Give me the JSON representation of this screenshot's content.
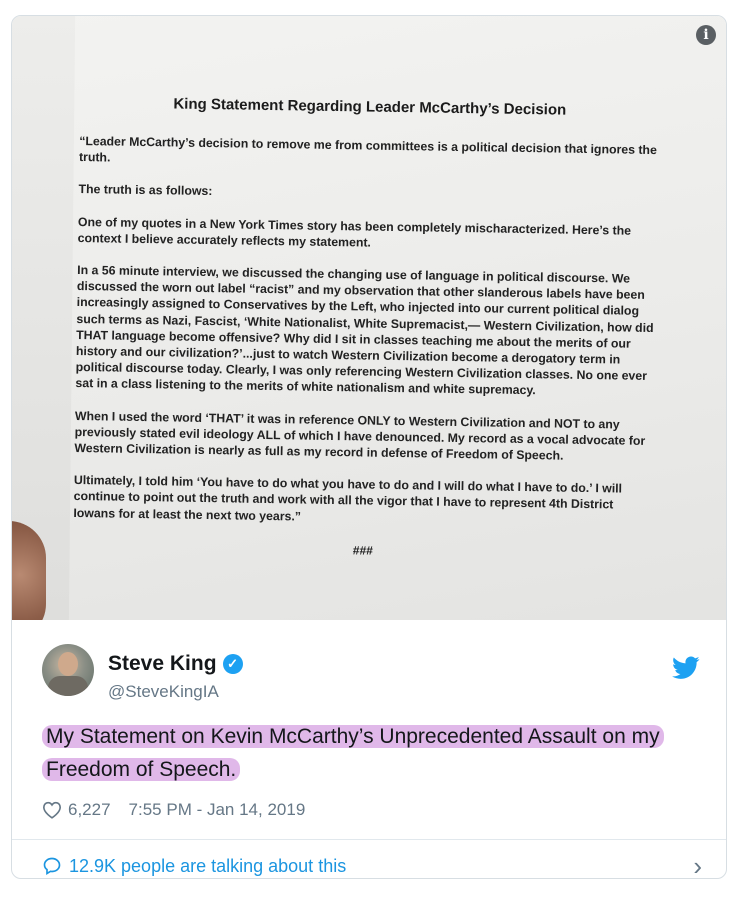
{
  "document": {
    "title": "King Statement Regarding Leader McCarthy’s Decision",
    "paragraphs": [
      "“Leader McCarthy’s decision to remove me from committees is a political decision that ignores the truth.",
      "The truth is as follows:",
      "One of my quotes in a New York Times story has been completely mischaracterized. Here’s the context I believe accurately reflects my statement.",
      "In a 56 minute interview, we discussed the changing use of language in political discourse. We discussed the worn out label “racist” and my observation that other slanderous labels have been increasingly assigned to Conservatives by the Left, who injected into our current political dialog such terms as Nazi, Fascist, ‘White Nationalist, White Supremacist,— Western Civilization, how did THAT language become offensive? Why did I sit in classes teaching me about the merits of our history and our civilization?’...just to watch Western Civilization become a derogatory term in political discourse today. Clearly, I was only referencing Western Civilization classes. No one ever sat in a class listening to the merits of white nationalism and white supremacy.",
      "When I used the word ‘THAT’ it was in reference ONLY to Western Civilization and NOT to any previously stated evil ideology ALL of which I have denounced. My record as a vocal advocate for Western Civilization is nearly as full as my record in defense of Freedom of Speech.",
      "Ultimately, I told him ‘You have to do what you have to do and I will do what I have to do.’ I will continue to point out the truth and work with all the vigor that I have to represent 4th District Iowans for at least the next two years.”"
    ],
    "end_marker": "###"
  },
  "tweet": {
    "display_name": "Steve King",
    "handle": "@SteveKingIA",
    "text": "My Statement on Kevin McCarthy’s Unprecedented Assault on my Freedom of Speech.",
    "likes": "6,227",
    "timestamp": "7:55 PM - Jan 14, 2019",
    "talking": "12.9K people are talking about this"
  },
  "icons": {
    "info": "info-icon",
    "verified": "verified-badge-icon",
    "brand": "twitter-bird-icon",
    "like": "heart-icon",
    "talk": "speech-bubble-icon",
    "chevron": "chevron-right-icon"
  },
  "colors": {
    "brand_blue": "#1da1f2",
    "link_blue": "#1b95e0",
    "highlight": "#d6a0e2",
    "muted": "#657786"
  }
}
